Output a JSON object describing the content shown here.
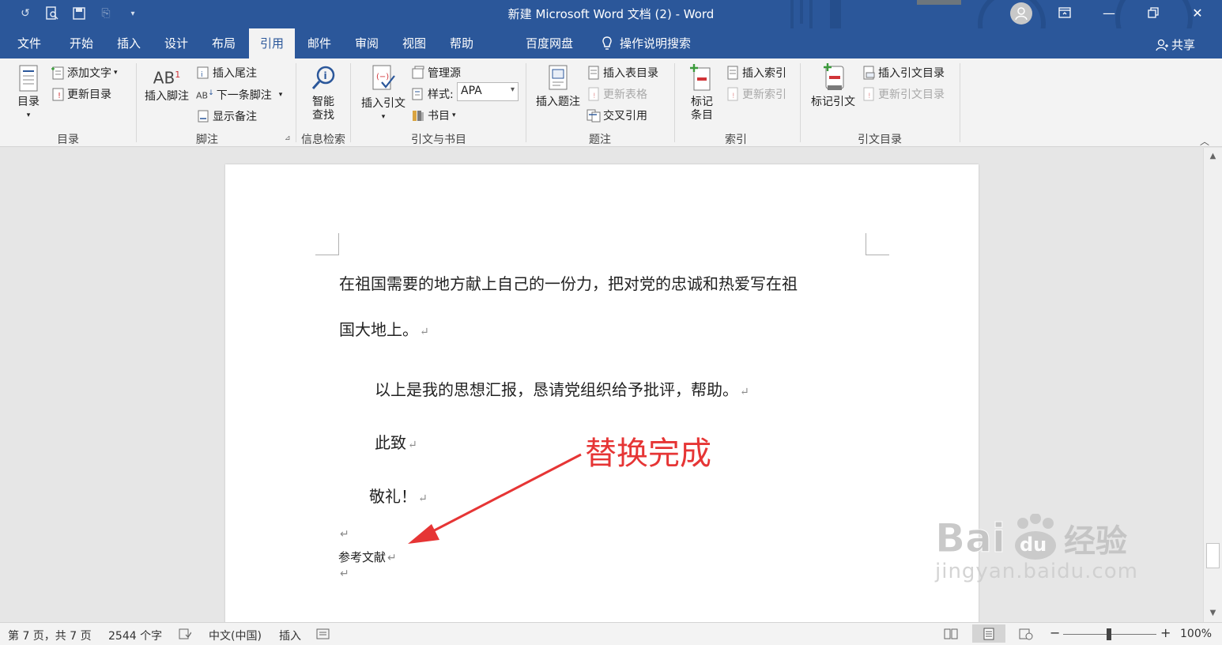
{
  "window": {
    "title": "新建 Microsoft Word 文档 (2)  -  Word"
  },
  "tabs": [
    {
      "label": "文件"
    },
    {
      "label": "开始"
    },
    {
      "label": "插入"
    },
    {
      "label": "设计"
    },
    {
      "label": "布局"
    },
    {
      "label": "引用",
      "active": true
    },
    {
      "label": "邮件"
    },
    {
      "label": "审阅"
    },
    {
      "label": "视图"
    },
    {
      "label": "帮助"
    },
    {
      "label": "百度网盘"
    },
    {
      "label": "操作说明搜索"
    }
  ],
  "share_label": "共享",
  "ribbon": {
    "toc": {
      "group": "目录",
      "toc_button": "目录",
      "add_text": "添加文字",
      "update_toc": "更新目录"
    },
    "footnotes": {
      "group": "脚注",
      "insert_footnote": "插入脚注",
      "insert_endnote": "插入尾注",
      "next_footnote": "下一条脚注",
      "show_notes": "显示备注"
    },
    "research": {
      "group": "信息检索",
      "smart_lookup_1": "智能",
      "smart_lookup_2": "查找"
    },
    "citations": {
      "group": "引文与书目",
      "insert_citation": "插入引文",
      "manage_sources": "管理源",
      "style_label": "样式:",
      "style_value": "APA",
      "bibliography": "书目"
    },
    "captions": {
      "group": "题注",
      "insert_caption": "插入题注",
      "insert_table_of_figures": "插入表目录",
      "update_table": "更新表格",
      "cross_reference": "交叉引用"
    },
    "index": {
      "group": "索引",
      "mark_entry_1": "标记",
      "mark_entry_2": "条目",
      "insert_index": "插入索引",
      "update_index": "更新索引"
    },
    "authorities": {
      "group": "引文目录",
      "mark_citation": "标记引文",
      "insert_toa": "插入引文目录",
      "update_toa": "更新引文目录"
    }
  },
  "document": {
    "line1": "在祖国需要的地方献上自己的一份力，把对党的忠诚和热爱写在祖",
    "line2": "国大地上。",
    "line3": "以上是我的思想汇报，恳请党组织给予批评，帮助。",
    "line4": "此致",
    "line5": "敬礼！",
    "line6": "参考文献",
    "para_mark": "↵"
  },
  "annotation": "替换完成",
  "watermark": {
    "brand": "Bai",
    "brand2": "du",
    "suffix": "经验",
    "url": "jingyan.baidu.com"
  },
  "statusbar": {
    "page": "第 7 页，共 7 页",
    "words": "2544 个字",
    "language": "中文(中国)",
    "mode": "插入",
    "zoom": "100%",
    "zoom_minus": "−",
    "zoom_plus": "+"
  },
  "colors": {
    "titlebar": "#2b579a",
    "annotation": "#e63535"
  }
}
